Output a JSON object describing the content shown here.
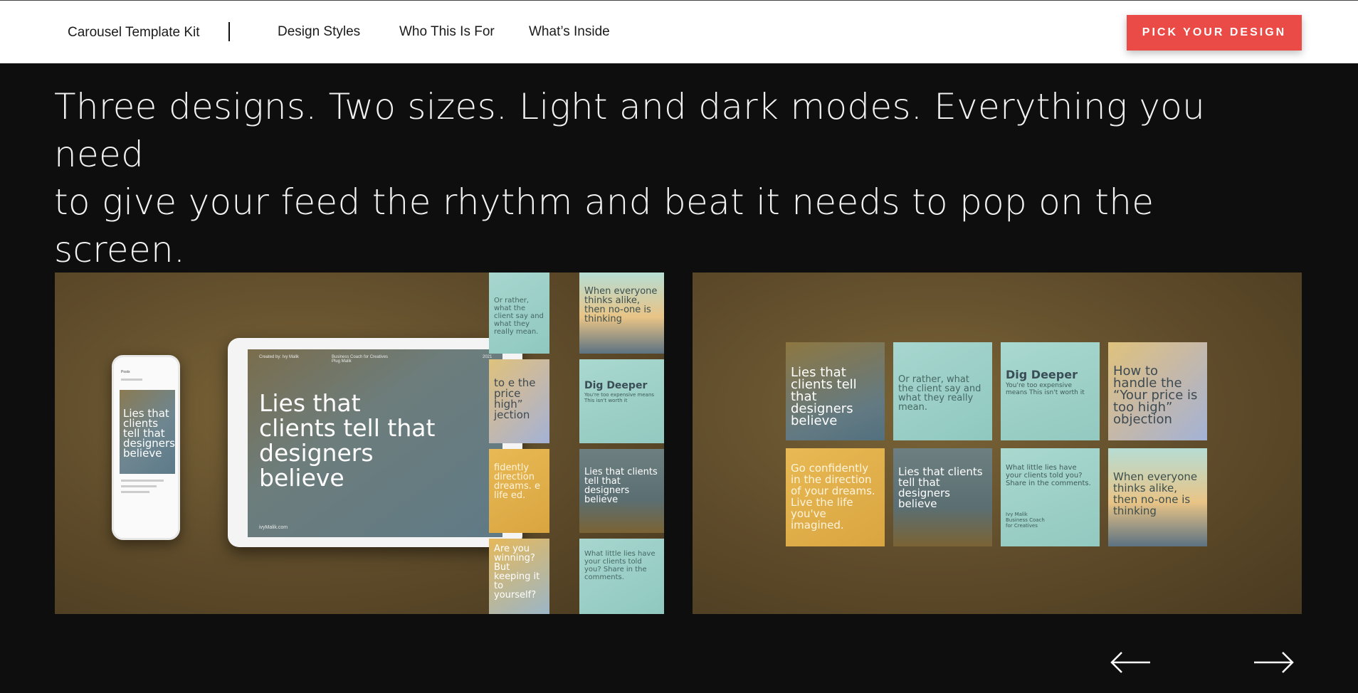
{
  "nav": {
    "brand": "Carousel Template Kit",
    "links": [
      "Design Styles",
      "Who This Is For",
      "What’s Inside"
    ],
    "cta": "PICK YOUR DESIGN"
  },
  "hero": {
    "headline_line1": "Three designs. Two sizes. Light and dark modes. Everything you need",
    "headline_line2": "to give your feed the rhythm and beat it needs to pop on the screen."
  },
  "slide1": {
    "phone_app": "Posts",
    "phone_text": "Lies that clients tell that designers believe",
    "tablet_meta_left": "Created by: Ivy Malik",
    "tablet_meta_mid": "Business Coach for Creatives Plug Malik",
    "tablet_meta_right": "2021",
    "tablet_title": "Lies that clients tell that designers believe",
    "tablet_url": "ivyMalik.com",
    "tiles": {
      "rather": "Or rather, what the client say and what they really mean.",
      "everyone": "When everyone thinks alike, then no-one is thinking",
      "price": "to e the price high” jection",
      "dig_title": "Dig Deeper",
      "dig_sub": "You're too expensive means This isn't worth it",
      "confident": "fidently direction dreams. e life ed.",
      "lies": "Lies that clients tell that designers believe",
      "winning": "Are you winning? But keeping it to yourself?",
      "little": "What little lies have your clients told you? Share in the comments."
    }
  },
  "slide2": {
    "tiles": {
      "lies1": "Lies that clients tell that designers believe",
      "rather": "Or rather, what the client say and what they really mean.",
      "dig_title": "Dig Deeper",
      "dig_sub": "You're too expensive means This isn't worth it",
      "price": "How to handle the “Your price is too high” objection",
      "confident": "Go confidently in the direction of your dreams. Live the life you've imagined.",
      "lies2": "Lies that clients tell that designers believe",
      "little": "What little lies have your clients told you? Share in the comments.",
      "coach": "Ivy Malik Business Coach for Creatives",
      "everyone": "When everyone thinks alike, then no-one is thinking"
    }
  },
  "controls": {
    "prev_icon": "arrow-left-icon",
    "next_icon": "arrow-right-icon"
  }
}
